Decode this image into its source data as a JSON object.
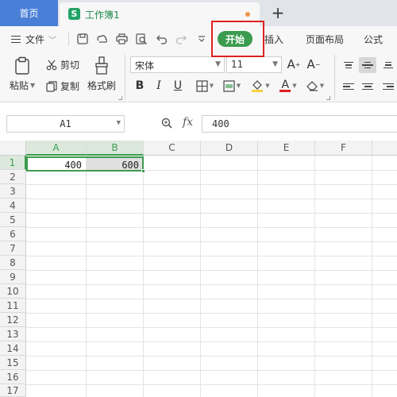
{
  "tabs": {
    "home_label": "首页",
    "doc_icon": "S",
    "doc_title": "工作簿1",
    "add_symbol": "+"
  },
  "menu": {
    "file_label": "文件",
    "start_label": "开始",
    "insert_label": "插入",
    "layout_label": "页面布局",
    "formula_label": "公式"
  },
  "ribbon": {
    "paste_label": "粘贴",
    "cut_label": "剪切",
    "copy_label": "复制",
    "format_painter_label": "格式刷",
    "font_name": "宋体",
    "font_size": "11",
    "bold": "B",
    "italic": "I",
    "underline": "U",
    "font_color_letter": "A"
  },
  "formula_bar": {
    "cell_ref": "A1",
    "fx": "fx",
    "value": "400"
  },
  "sheet": {
    "columns": [
      "A",
      "B",
      "C",
      "D",
      "E",
      "F"
    ],
    "rows": [
      "1",
      "2",
      "3",
      "4",
      "5",
      "6",
      "7",
      "8",
      "9",
      "10",
      "11",
      "12",
      "13",
      "14",
      "15",
      "16",
      "17"
    ],
    "cells": {
      "A1": "400",
      "B1": "600"
    }
  },
  "colors": {
    "accent_green": "#3b9c4f",
    "home_tab_blue": "#4a7fd8",
    "highlight_red": "#e02020"
  }
}
